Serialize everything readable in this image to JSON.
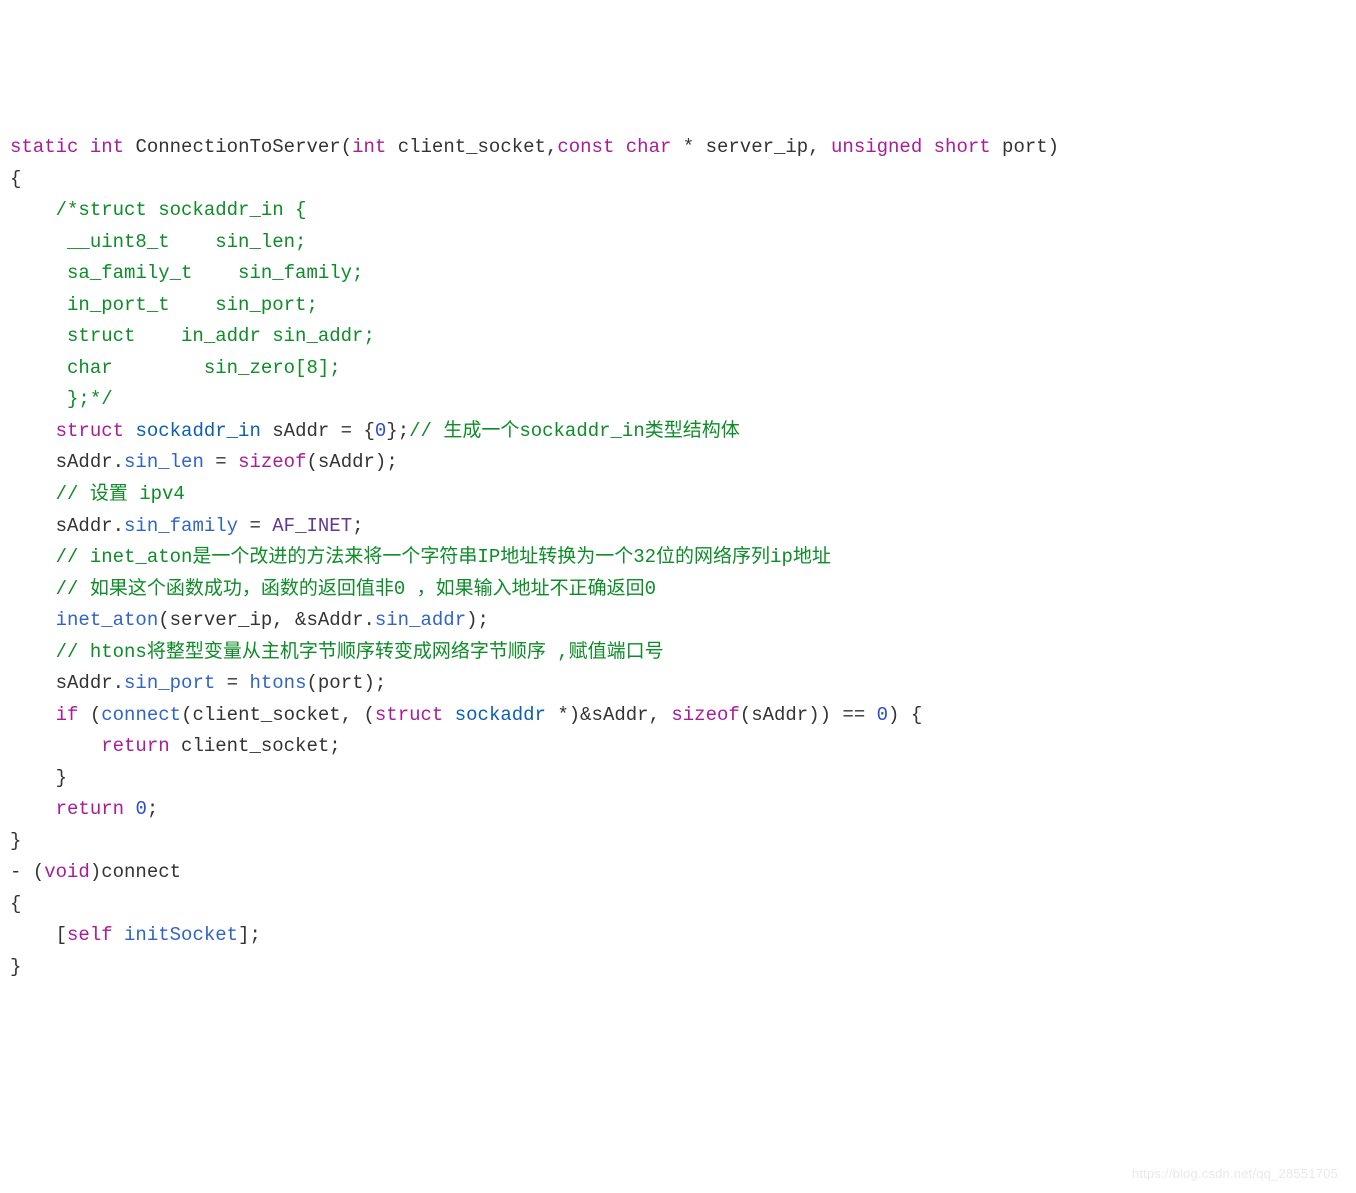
{
  "lines": [
    {
      "segments": [
        {
          "t": "static",
          "c": "kw"
        },
        {
          "t": " "
        },
        {
          "t": "int",
          "c": "kw"
        },
        {
          "t": " ConnectionToServer("
        },
        {
          "t": "int",
          "c": "kw"
        },
        {
          "t": " client_socket,"
        },
        {
          "t": "const",
          "c": "kw"
        },
        {
          "t": " "
        },
        {
          "t": "char",
          "c": "kw"
        },
        {
          "t": " * server_ip, "
        },
        {
          "t": "unsigned",
          "c": "kw"
        },
        {
          "t": " "
        },
        {
          "t": "short",
          "c": "kw"
        },
        {
          "t": " port)"
        }
      ]
    },
    {
      "segments": [
        {
          "t": "{"
        }
      ]
    },
    {
      "segments": [
        {
          "t": "    "
        },
        {
          "t": "/*struct sockaddr_in {",
          "c": "comment"
        }
      ]
    },
    {
      "segments": [
        {
          "t": "     "
        },
        {
          "t": "__uint8_t    sin_len;",
          "c": "comment"
        }
      ]
    },
    {
      "segments": [
        {
          "t": "     "
        },
        {
          "t": "sa_family_t    sin_family;",
          "c": "comment"
        }
      ]
    },
    {
      "segments": [
        {
          "t": "     "
        },
        {
          "t": "in_port_t    sin_port;",
          "c": "comment"
        }
      ]
    },
    {
      "segments": [
        {
          "t": "     "
        },
        {
          "t": "struct    in_addr sin_addr;",
          "c": "comment"
        }
      ]
    },
    {
      "segments": [
        {
          "t": "     "
        },
        {
          "t": "char        sin_zero[8];",
          "c": "comment"
        }
      ]
    },
    {
      "segments": [
        {
          "t": "     "
        },
        {
          "t": "};*/",
          "c": "comment"
        }
      ]
    },
    {
      "segments": [
        {
          "t": "    "
        },
        {
          "t": "struct",
          "c": "kw"
        },
        {
          "t": " "
        },
        {
          "t": "sockaddr_in",
          "c": "type"
        },
        {
          "t": " sAddr = {"
        },
        {
          "t": "0",
          "c": "num"
        },
        {
          "t": "};"
        },
        {
          "t": "// 生成一个sockaddr_in类型结构体",
          "c": "comment"
        }
      ]
    },
    {
      "segments": [
        {
          "t": "    sAddr."
        },
        {
          "t": "sin_len",
          "c": "prop"
        },
        {
          "t": " = "
        },
        {
          "t": "sizeof",
          "c": "kw"
        },
        {
          "t": "(sAddr);"
        }
      ]
    },
    {
      "segments": [
        {
          "t": "    "
        },
        {
          "t": "// 设置 ipv4",
          "c": "comment"
        }
      ]
    },
    {
      "segments": [
        {
          "t": "    sAddr."
        },
        {
          "t": "sin_family",
          "c": "prop"
        },
        {
          "t": " = "
        },
        {
          "t": "AF_INET",
          "c": "macro"
        },
        {
          "t": ";"
        }
      ]
    },
    {
      "segments": [
        {
          "t": "    "
        },
        {
          "t": "// inet_aton是一个改进的方法来将一个字符串IP地址转换为一个32位的网络序列ip地址",
          "c": "comment"
        }
      ]
    },
    {
      "segments": [
        {
          "t": "    "
        },
        {
          "t": "// 如果这个函数成功，函数的返回值非0 ，如果输入地址不正确返回0",
          "c": "comment"
        }
      ]
    },
    {
      "segments": [
        {
          "t": "    "
        },
        {
          "t": "inet_aton",
          "c": "func"
        },
        {
          "t": "(server_ip, &sAddr."
        },
        {
          "t": "sin_addr",
          "c": "prop"
        },
        {
          "t": ");"
        }
      ]
    },
    {
      "segments": [
        {
          "t": "    "
        },
        {
          "t": "// htons将整型变量从主机字节顺序转变成网络字节顺序 ,赋值端口号",
          "c": "comment"
        }
      ]
    },
    {
      "segments": [
        {
          "t": "    sAddr."
        },
        {
          "t": "sin_port",
          "c": "prop"
        },
        {
          "t": " = "
        },
        {
          "t": "htons",
          "c": "func"
        },
        {
          "t": "(port);"
        }
      ]
    },
    {
      "segments": [
        {
          "t": "    "
        },
        {
          "t": "if",
          "c": "kw"
        },
        {
          "t": " ("
        },
        {
          "t": "connect",
          "c": "func"
        },
        {
          "t": "(client_socket, ("
        },
        {
          "t": "struct",
          "c": "kw"
        },
        {
          "t": " "
        },
        {
          "t": "sockaddr",
          "c": "type"
        },
        {
          "t": " *)&sAddr, "
        },
        {
          "t": "sizeof",
          "c": "kw"
        },
        {
          "t": "(sAddr)) == "
        },
        {
          "t": "0",
          "c": "num"
        },
        {
          "t": ") {"
        }
      ]
    },
    {
      "segments": [
        {
          "t": "        "
        },
        {
          "t": "return",
          "c": "kw"
        },
        {
          "t": " client_socket;"
        }
      ]
    },
    {
      "segments": [
        {
          "t": "    }"
        }
      ]
    },
    {
      "segments": [
        {
          "t": "    "
        },
        {
          "t": "return",
          "c": "kw"
        },
        {
          "t": " "
        },
        {
          "t": "0",
          "c": "num"
        },
        {
          "t": ";"
        }
      ]
    },
    {
      "segments": [
        {
          "t": "}"
        }
      ]
    },
    {
      "segments": [
        {
          "t": "- ("
        },
        {
          "t": "void",
          "c": "kw"
        },
        {
          "t": ")connect"
        }
      ]
    },
    {
      "segments": [
        {
          "t": "{"
        }
      ]
    },
    {
      "segments": [
        {
          "t": "    ["
        },
        {
          "t": "self",
          "c": "kw"
        },
        {
          "t": " "
        },
        {
          "t": "initSocket",
          "c": "func"
        },
        {
          "t": "];"
        }
      ]
    },
    {
      "segments": [
        {
          "t": "}"
        }
      ]
    }
  ],
  "watermark": "https://blog.csdn.net/qq_28551705"
}
